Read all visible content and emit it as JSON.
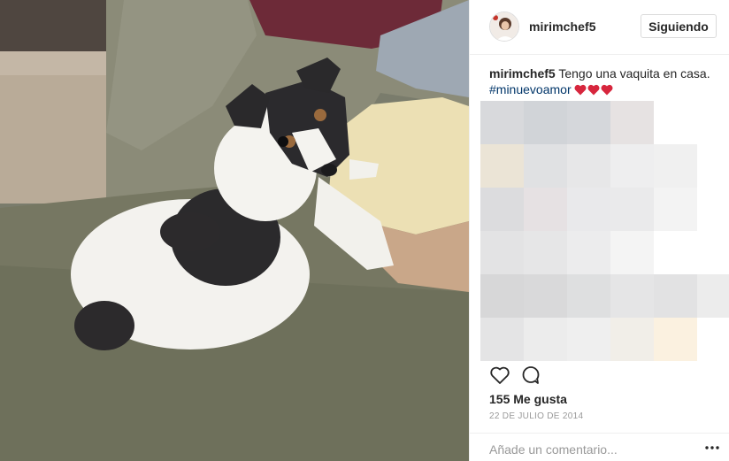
{
  "post": {
    "photo": {
      "alt": "puppy-on-sofa"
    },
    "header": {
      "username": "mirimchef5",
      "follow_label": "Siguiendo",
      "avatar_icon": "profile-avatar"
    },
    "caption": {
      "username": "mirimchef5",
      "text": "Tengo una vaquita en casa.",
      "hashtag": "#minuevoamor",
      "hearts_icon": "red-heart-emoji",
      "hearts_count": 3
    },
    "comments": {
      "state": "pixelated-obscured"
    },
    "actions": {
      "like_icon": "heart-outline-icon",
      "comment_icon": "comment-bubble-icon"
    },
    "likes_text": "155 Me gusta",
    "date_text": "22 DE JULIO DE 2014",
    "comment_box": {
      "placeholder": "Añade un comentario...",
      "more_icon": "more-options-icon"
    },
    "colors": {
      "hashtag": "#003569",
      "heart": "#d7263d",
      "border": "#efefef",
      "meta_text": "#999999"
    }
  }
}
